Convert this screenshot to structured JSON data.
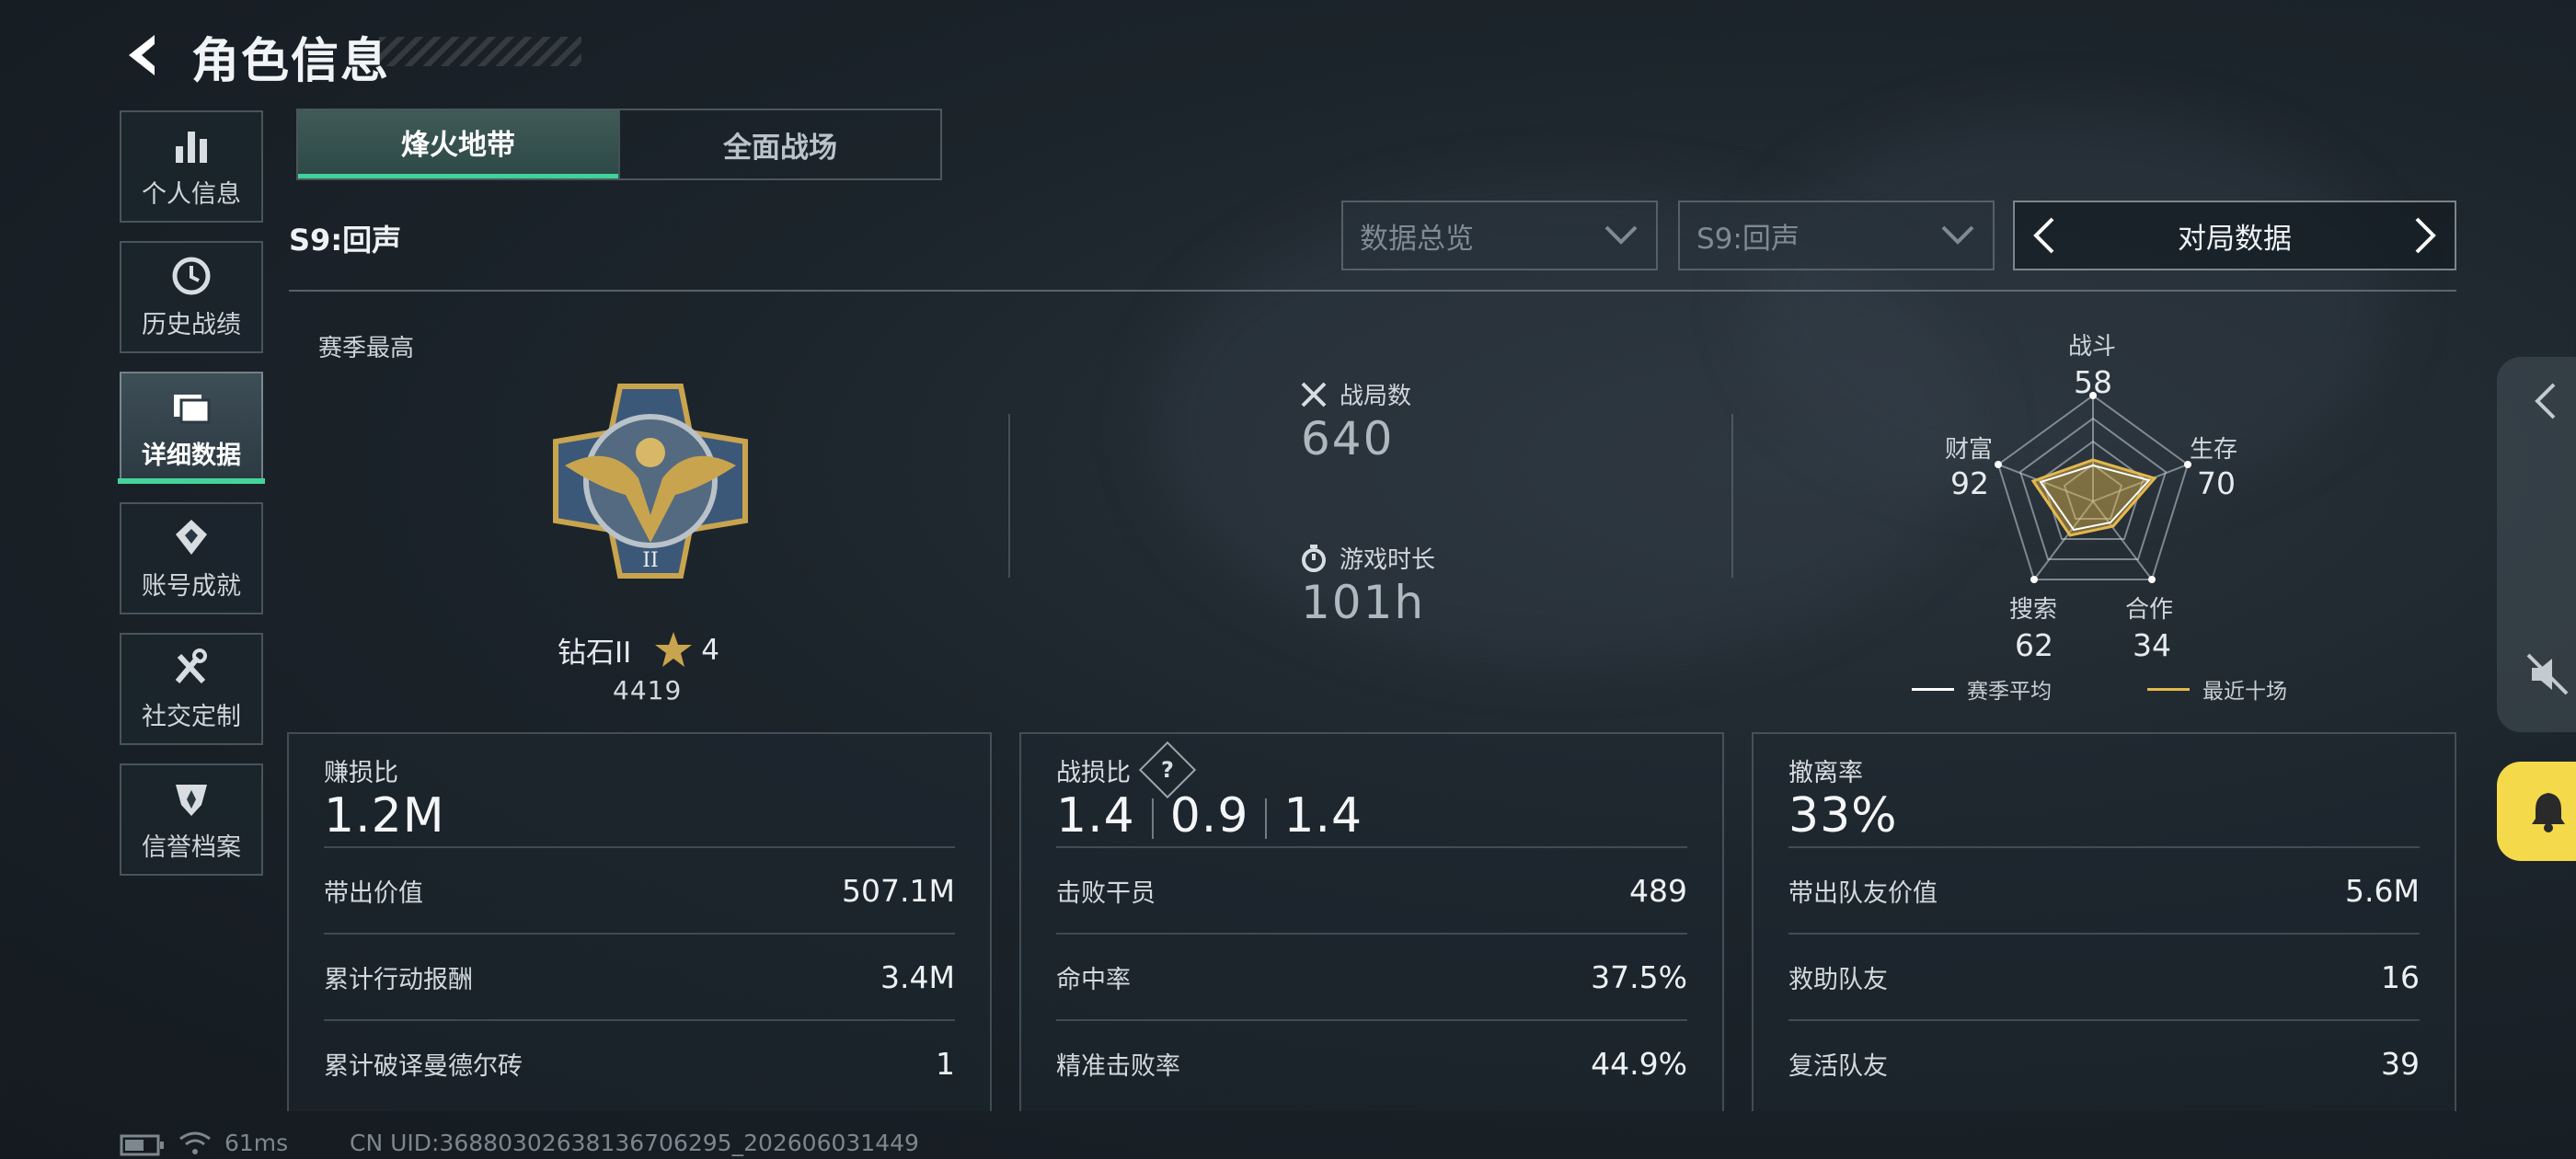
{
  "header": {
    "title": "角色信息"
  },
  "sidebar": {
    "items": [
      {
        "label": "个人信息",
        "icon": "bar-chart-icon"
      },
      {
        "label": "历史战绩",
        "icon": "history-clock-icon"
      },
      {
        "label": "详细数据",
        "icon": "folder-icon",
        "active": true
      },
      {
        "label": "账号成就",
        "icon": "achievement-badge-icon"
      },
      {
        "label": "社交定制",
        "icon": "tools-icon"
      },
      {
        "label": "信誉档案",
        "icon": "shield-icon"
      }
    ]
  },
  "mode_tabs": [
    {
      "label": "烽火地带",
      "active": true
    },
    {
      "label": "全面战场",
      "active": false
    }
  ],
  "season": {
    "label": "S9:回声"
  },
  "filters": {
    "data_dropdown": "数据总览",
    "season_dropdown": "S9:回声",
    "pager_label": "对局数据"
  },
  "rank": {
    "section_label": "赛季最高",
    "name": "钻石II",
    "stars": "4",
    "score": "4419"
  },
  "summary": {
    "matches_label": "战局数",
    "matches_value": "640",
    "playtime_label": "游戏时长",
    "playtime_value": "101h"
  },
  "radar": {
    "axes": [
      {
        "label": "战斗",
        "value": "58"
      },
      {
        "label": "生存",
        "value": "70"
      },
      {
        "label": "合作",
        "value": "34"
      },
      {
        "label": "搜索",
        "value": "62"
      },
      {
        "label": "财富",
        "value": "92"
      }
    ],
    "legend_season": "赛季平均",
    "legend_recent": "最近十场",
    "colors": {
      "season": "#ffffff",
      "recent": "#e5b84a"
    }
  },
  "panels": {
    "profit": {
      "label": "赚损比",
      "value": "1.2M",
      "rows": [
        {
          "label": "带出价值",
          "value": "507.1M"
        },
        {
          "label": "累计行动报酬",
          "value": "3.4M"
        },
        {
          "label": "累计破译曼德尔砖",
          "value": "1"
        }
      ]
    },
    "kd": {
      "label": "战损比",
      "help": "?",
      "values": [
        "1.4",
        "0.9",
        "1.4"
      ],
      "rows": [
        {
          "label": "击败干员",
          "value": "489"
        },
        {
          "label": "命中率",
          "value": "37.5%"
        },
        {
          "label": "精准击败率",
          "value": "44.9%"
        }
      ]
    },
    "extract": {
      "label": "撤离率",
      "value": "33%",
      "rows": [
        {
          "label": "带出队友价值",
          "value": "5.6M"
        },
        {
          "label": "救助队友",
          "value": "16"
        },
        {
          "label": "复活队友",
          "value": "39"
        }
      ]
    }
  },
  "footer": {
    "ping": "61ms",
    "uid": "CN UID:368803026381367062​95_202606031449"
  },
  "accent": "#3fd39a"
}
